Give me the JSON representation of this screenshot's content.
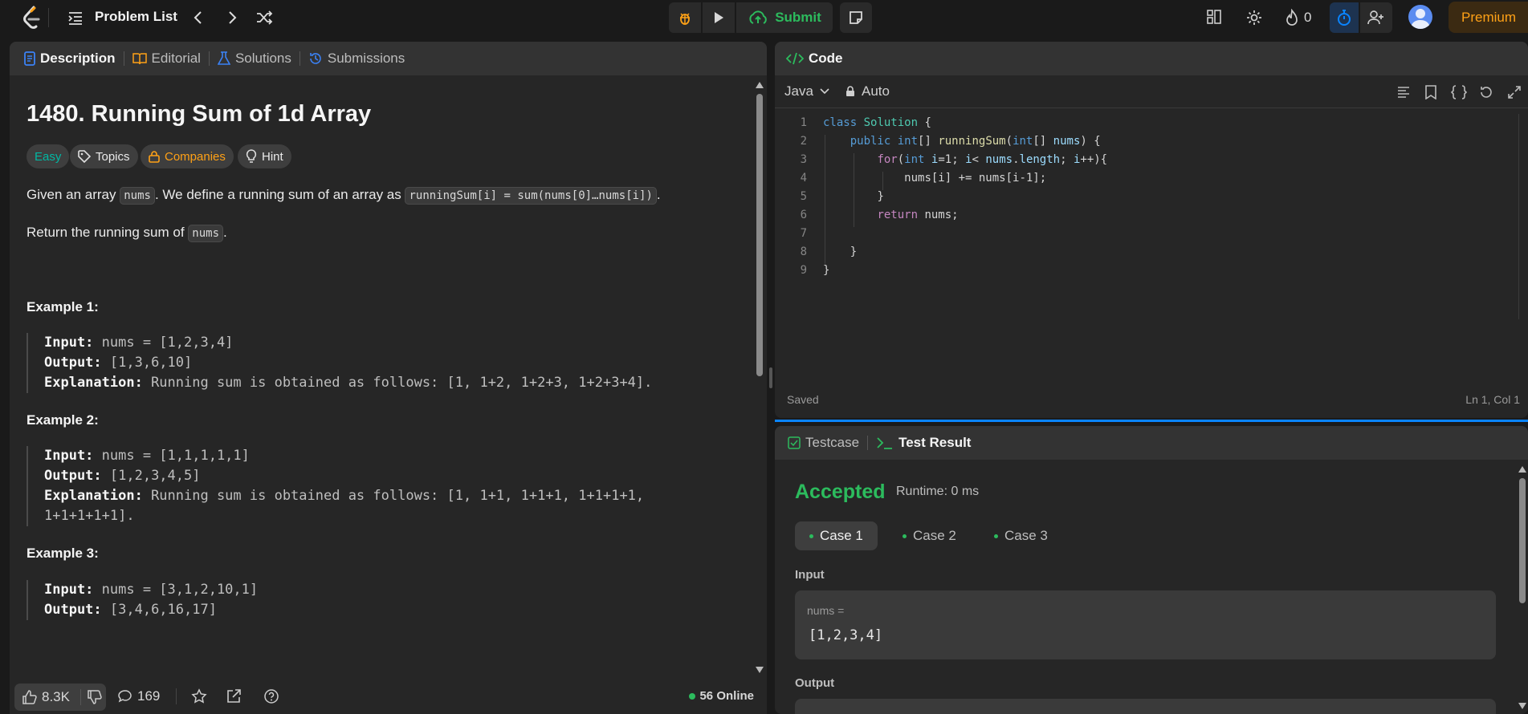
{
  "header": {
    "problem_list_label": "Problem List",
    "submit_label": "Submit",
    "streak_count": "0",
    "premium_label": "Premium"
  },
  "description": {
    "tabs": [
      {
        "label": "Description",
        "active": true
      },
      {
        "label": "Editorial",
        "active": false
      },
      {
        "label": "Solutions",
        "active": false
      },
      {
        "label": "Submissions",
        "active": false
      }
    ],
    "title": "1480. Running Sum of 1d Array",
    "chips": {
      "difficulty": "Easy",
      "topics": "Topics",
      "companies": "Companies",
      "hint": "Hint"
    },
    "paragraph1": {
      "pre": "Given an array ",
      "code1": "nums",
      "mid": ". We define a running sum of an array as ",
      "code2": "runningSum[i] = sum(nums[0]…nums[i])",
      "post": "."
    },
    "paragraph2": {
      "pre": "Return the running sum of ",
      "code1": "nums",
      "post": "."
    },
    "examples": [
      {
        "heading": "Example 1:",
        "input_label": "Input:",
        "input_value": " nums = [1,2,3,4]",
        "output_label": "Output:",
        "output_value": " [1,3,6,10]",
        "explanation_label": "Explanation:",
        "explanation_value": " Running sum is obtained as follows: [1, 1+2, 1+2+3, 1+2+3+4]."
      },
      {
        "heading": "Example 2:",
        "input_label": "Input:",
        "input_value": " nums = [1,1,1,1,1]",
        "output_label": "Output:",
        "output_value": " [1,2,3,4,5]",
        "explanation_label": "Explanation:",
        "explanation_value": " Running sum is obtained as follows: [1, 1+1, 1+1+1, 1+1+1+1,",
        "explanation_cont": "1+1+1+1+1]."
      },
      {
        "heading": "Example 3:",
        "input_label": "Input:",
        "input_value": " nums = [3,1,2,10,1]",
        "output_label": "Output:",
        "output_value": " [3,4,6,16,17]"
      }
    ],
    "footer": {
      "likes": "8.3K",
      "comments": "169",
      "online": "56 Online"
    }
  },
  "code": {
    "tab_label": "Code",
    "language": "Java",
    "auto_label": "Auto",
    "status": "Saved",
    "cursor": "Ln 1, Col 1",
    "line_numbers": [
      "1",
      "2",
      "3",
      "4",
      "5",
      "6",
      "7",
      "8",
      "9"
    ]
  },
  "result": {
    "tabs": [
      {
        "label": "Testcase",
        "active": false
      },
      {
        "label": "Test Result",
        "active": true
      }
    ],
    "verdict": "Accepted",
    "runtime": "Runtime: 0 ms",
    "cases": [
      "Case 1",
      "Case 2",
      "Case 3"
    ],
    "input_heading": "Input",
    "input_var": "nums =",
    "input_value": "[1,2,3,4]",
    "output_heading": "Output"
  },
  "colors": {
    "accent_green": "#2cbb5d",
    "accent_orange": "#ffa116",
    "easy_teal": "#00b8a3",
    "active_blue": "#0a84ff"
  }
}
